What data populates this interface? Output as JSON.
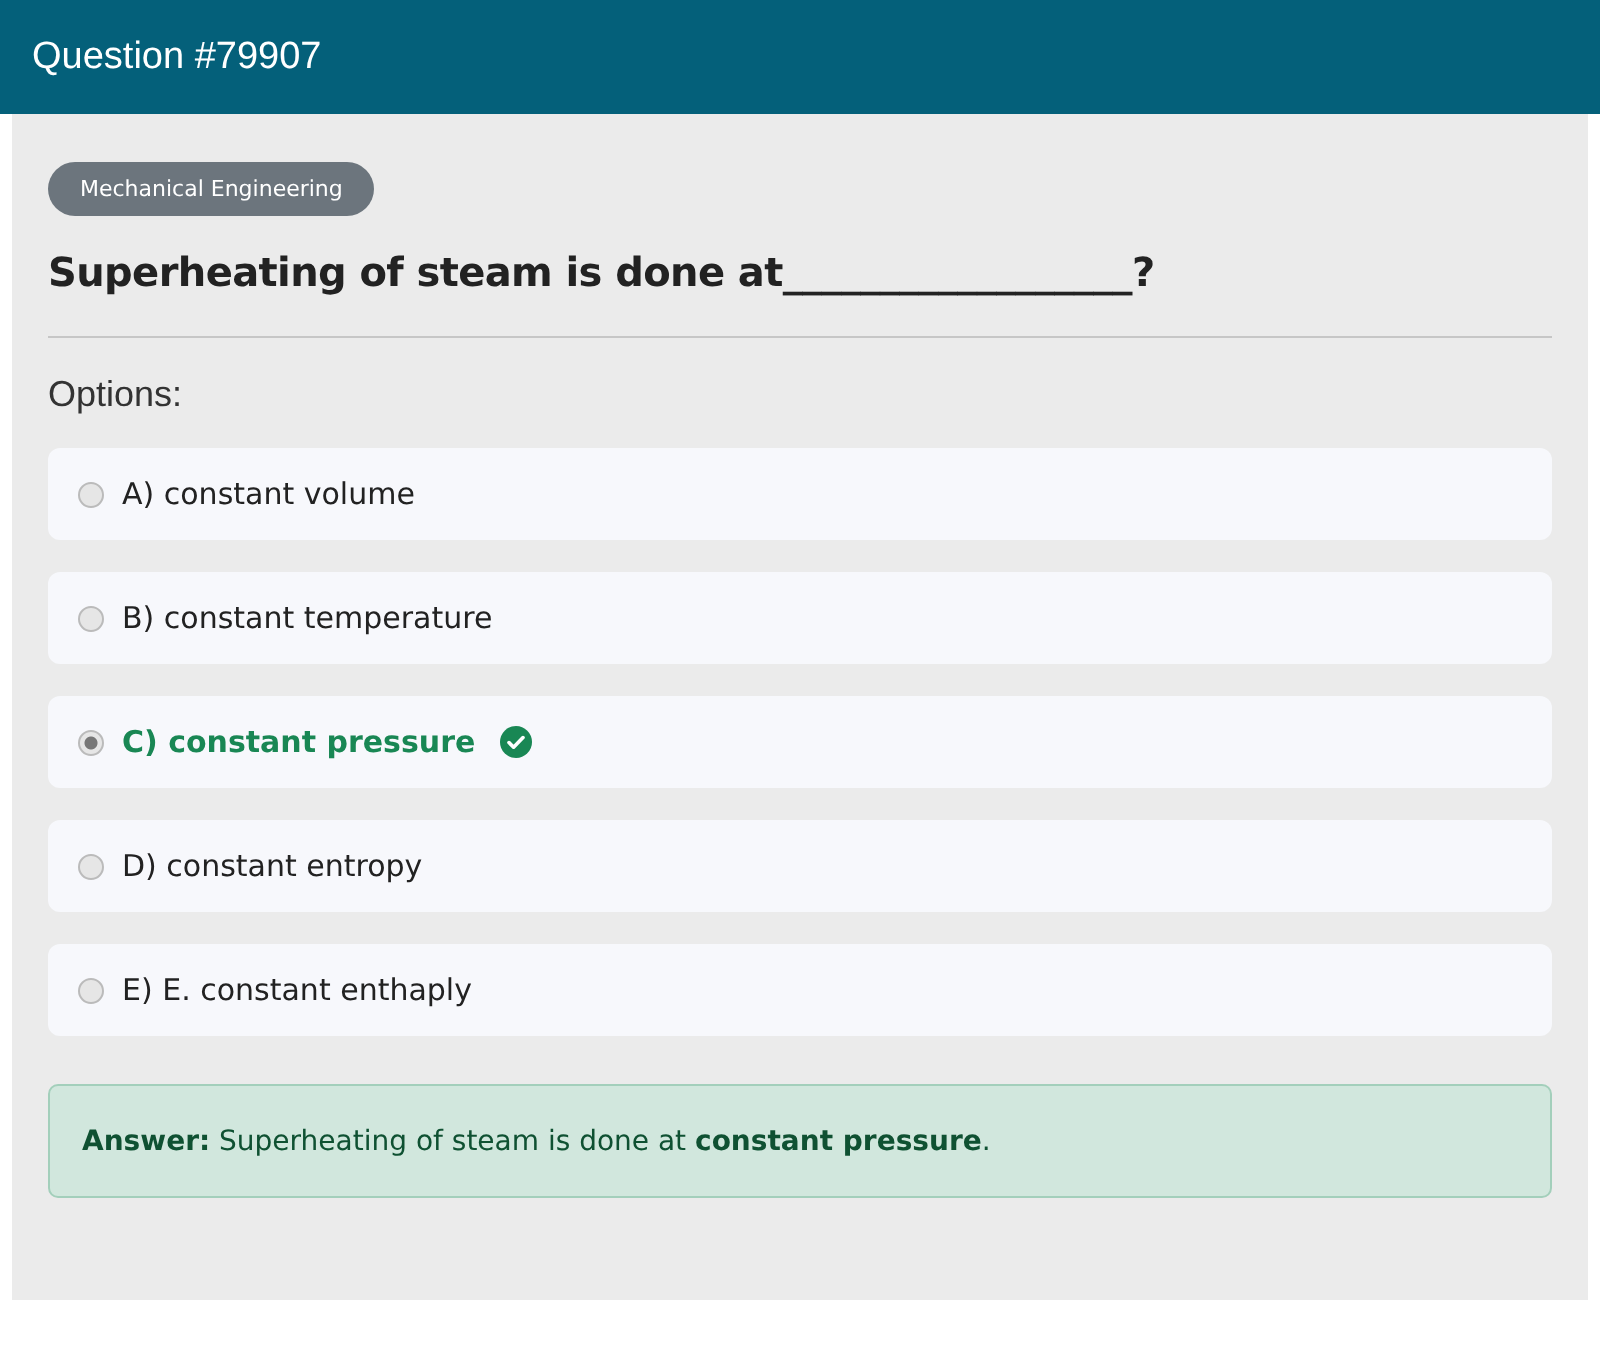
{
  "header": {
    "title": "Question #79907"
  },
  "category": "Mechanical Engineering",
  "question": "Superheating of steam is done at__________________?",
  "options_label": "Options:",
  "options": [
    {
      "label": "A) constant volume",
      "selected": false,
      "correct": false
    },
    {
      "label": "B) constant temperature",
      "selected": false,
      "correct": false
    },
    {
      "label": "C) constant pressure",
      "selected": true,
      "correct": true
    },
    {
      "label": "D) constant entropy",
      "selected": false,
      "correct": false
    },
    {
      "label": "E) E. constant enthaply",
      "selected": false,
      "correct": false
    }
  ],
  "answer": "**Answer:** Superheating of steam is done at **constant pressure**."
}
